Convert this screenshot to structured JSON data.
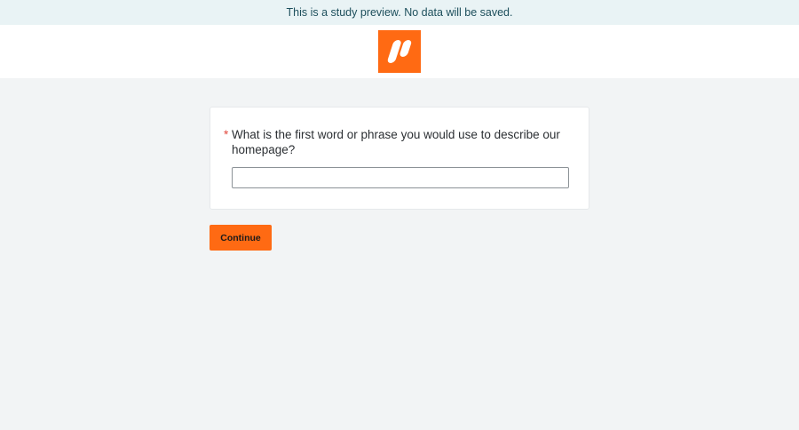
{
  "banner": {
    "text": "This is a study preview. No data will be saved."
  },
  "header": {
    "logo_icon": "brand-logo-icon",
    "logo_color": "#ff6a13"
  },
  "question": {
    "required_marker": "*",
    "text": "What is the first word or phrase you would use to describe our homepage?",
    "answer_value": "",
    "answer_placeholder": ""
  },
  "actions": {
    "continue_label": "Continue"
  },
  "colors": {
    "accent": "#ff6a13",
    "banner_background": "#e9f3f5",
    "page_background": "#f2f4f5"
  }
}
